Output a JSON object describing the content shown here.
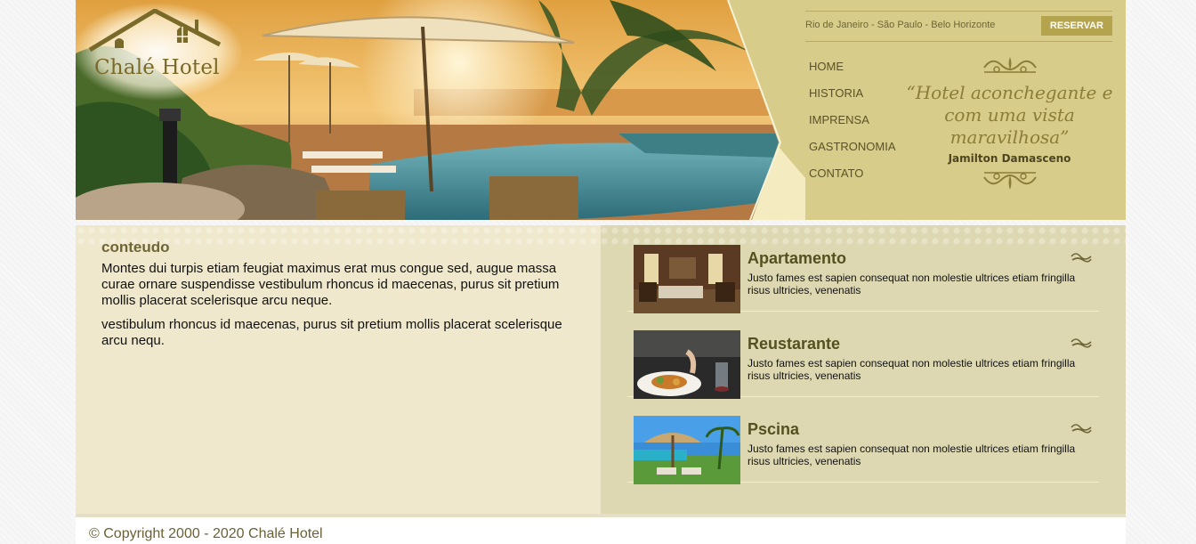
{
  "brand": {
    "name": "Chalé Hotel"
  },
  "topbar": {
    "cities": "Rio de Janeiro - São Paulo - Belo Horizonte",
    "reserve_label": "RESERVAR"
  },
  "nav": [
    "HOME",
    "HISTORIA",
    "IMPRENSA",
    "GASTRONOMIA",
    "CONTATO"
  ],
  "quote": {
    "text": "“Hotel aconchegante e com uma vista maravilhosa”",
    "author": "Jamilton Damasceno"
  },
  "content": {
    "title": "conteudo",
    "paragraphs": [
      "Montes dui turpis etiam feugiat maximus erat mus congue sed, augue massa curae ornare suspendisse vestibulum rhoncus id maecenas, purus sit pretium mollis placerat scelerisque arcu neque.",
      "vestibulum rhoncus id maecenas, purus sit pretium mollis placerat scelerisque arcu nequ."
    ]
  },
  "features": [
    {
      "title": "Apartamento",
      "description": "Justo fames est sapien consequat non molestie ultrices etiam fringilla risus ultricies, venenatis"
    },
    {
      "title": "Reustarante",
      "description": "Justo fames est sapien consequat non molestie ultrices etiam fringilla risus ultricies, venenatis"
    },
    {
      "title": "Pscina",
      "description": "Justo fames est sapien consequat non molestie ultrices etiam fringilla risus ultricies, venenatis"
    }
  ],
  "footer": {
    "copyright": "© Copyright 2000 - 2020 Chalé Hotel"
  },
  "colors": {
    "header_bg": "#d8cc8a",
    "left_panel": "#efe8cc",
    "right_panel": "#ddd8b2",
    "button": "#b5a44e",
    "heading": "#6e6536"
  }
}
